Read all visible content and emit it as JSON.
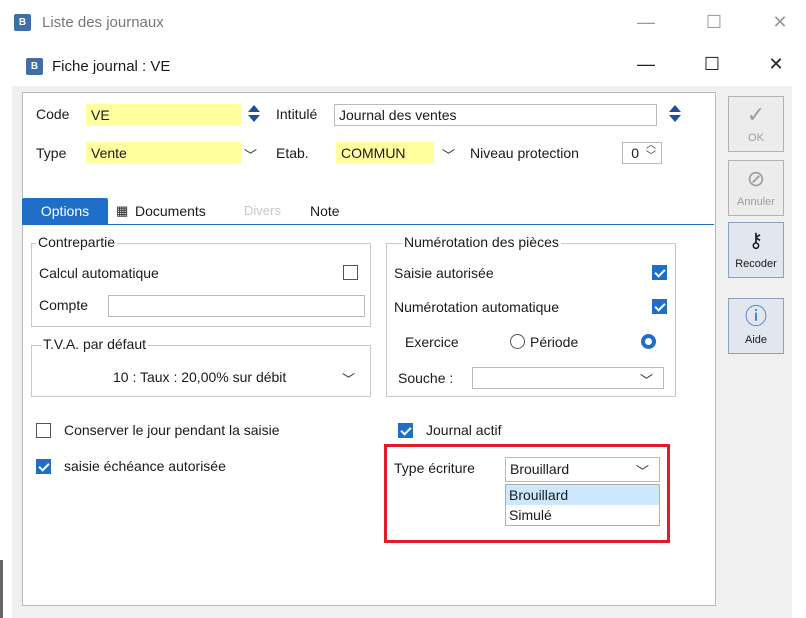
{
  "outer_window": {
    "title": "Liste des journaux",
    "app_icon": "book-icon"
  },
  "window": {
    "title": "Fiche journal : VE",
    "minimize": "—",
    "maximize": "☐",
    "close": "✕"
  },
  "header": {
    "code_label": "Code",
    "code_value": "VE",
    "intitule_label": "Intitulé",
    "intitule_value": "Journal des ventes",
    "type_label": "Type",
    "type_value": "Vente",
    "etab_label": "Etab.",
    "etab_value": "COMMUN",
    "niveau_label": "Niveau protection",
    "niveau_value": "0"
  },
  "tabs": [
    {
      "label": "Options",
      "active": true
    },
    {
      "label": "Documents",
      "icon": "table-icon"
    },
    {
      "label": "Divers",
      "disabled": true
    },
    {
      "label": "Note"
    }
  ],
  "contrepartie": {
    "title": "Contrepartie",
    "calcul_label": "Calcul automatique",
    "calcul_checked": false,
    "compte_label": "Compte",
    "compte_value": ""
  },
  "tva": {
    "title": "T.V.A. par défaut",
    "value": "10  : Taux : 20,00% sur débit"
  },
  "numerotation": {
    "title": "Numérotation des pièces",
    "saisie_label": "Saisie autorisée",
    "saisie_checked": true,
    "auto_label": "Numérotation automatique",
    "auto_checked": true,
    "exercice_label": "Exercice",
    "periode_label": "Période",
    "souche_label": "Souche :",
    "souche_value": ""
  },
  "options": {
    "conserver_label": "Conserver le jour pendant la saisie",
    "conserver_checked": false,
    "echeance_label": "saisie échéance autorisée",
    "echeance_checked": true,
    "actif_label": "Journal actif",
    "actif_checked": true
  },
  "type_ecriture": {
    "label": "Type écriture",
    "value": "Brouillard",
    "options": [
      "Brouillard",
      "Simulé"
    ],
    "selected_index": 0
  },
  "side_buttons": [
    {
      "label": "OK",
      "icon": "checkmark-icon",
      "enabled": false
    },
    {
      "label": "Annuler",
      "icon": "cancel-icon",
      "enabled": false
    },
    {
      "label": "Recoder",
      "icon": "key-icon",
      "enabled": true
    },
    {
      "label": "Aide",
      "icon": "help-icon",
      "enabled": true
    }
  ],
  "colors": {
    "accent": "#1f6fc9",
    "highlight": "#e01b24",
    "field_yellow": "#ffffa0"
  }
}
